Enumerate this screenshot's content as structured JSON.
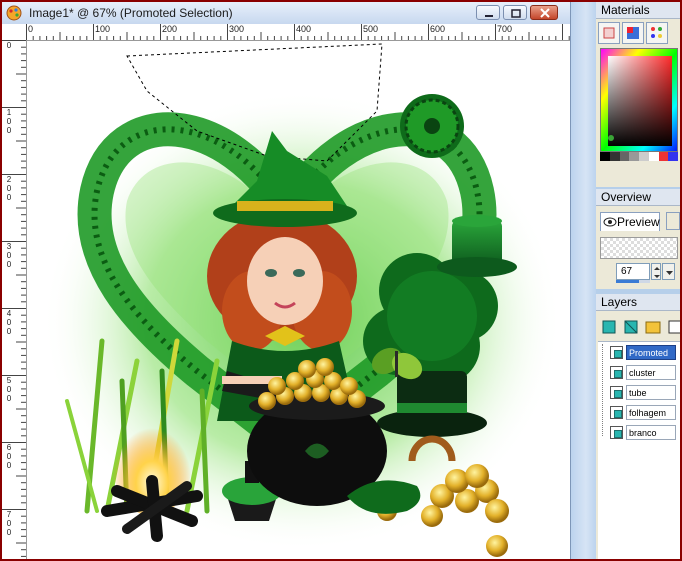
{
  "image_window": {
    "title": "Image1* @  67% (Promoted Selection)",
    "zoom_percent": 67,
    "ruler_top_labels": [
      "0",
      "100",
      "200",
      "300",
      "400",
      "500",
      "600",
      "700"
    ],
    "ruler_left_labels": [
      "0",
      "100",
      "200",
      "300",
      "400",
      "500",
      "600",
      "700"
    ]
  },
  "panels": {
    "materials": {
      "title": "Materials"
    },
    "overview": {
      "title": "Overview",
      "preview_tab": "Preview",
      "zoom_value": "67"
    },
    "layers": {
      "title": "Layers",
      "items": [
        {
          "name": "Promoted",
          "selected": true
        },
        {
          "name": "cluster",
          "selected": false
        },
        {
          "name": "tube",
          "selected": false
        },
        {
          "name": "folhagem",
          "selected": false
        },
        {
          "name": "branco",
          "selected": false
        }
      ]
    }
  },
  "colors": {
    "frame_border": "#8a0000",
    "selection_highlight": "#3169c6",
    "layer_icon": "#29b6b0"
  }
}
